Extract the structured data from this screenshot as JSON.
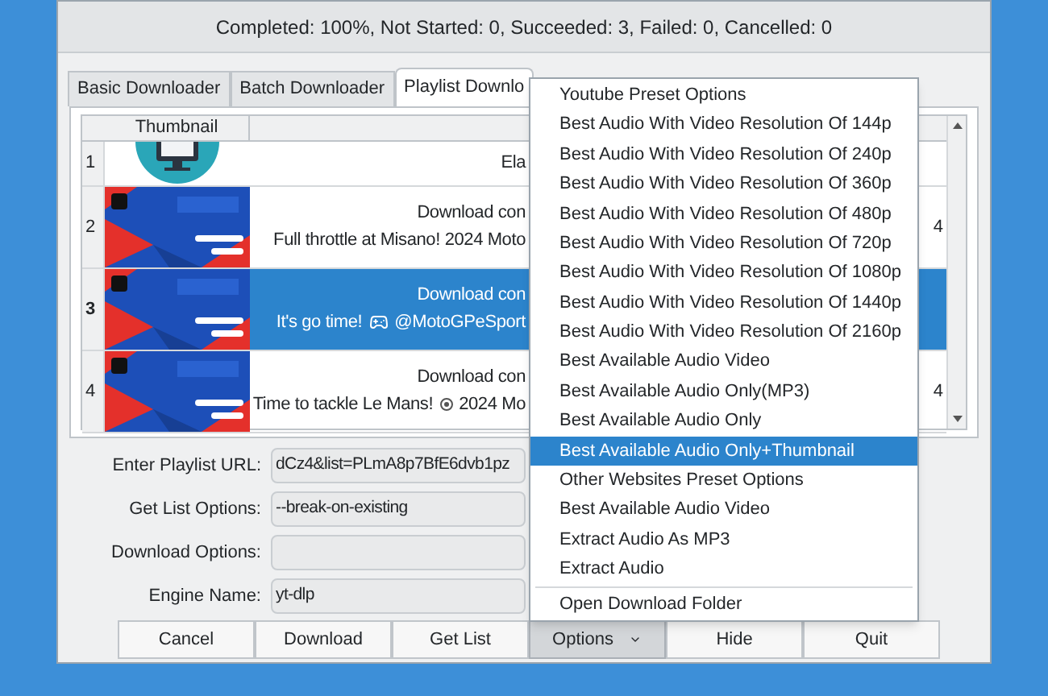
{
  "window": {
    "title": "Completed: 100%, Not Started: 0, Succeeded: 3, Failed: 0, Cancelled: 0"
  },
  "tabs": [
    {
      "label": "Basic Downloader",
      "selected": false
    },
    {
      "label": "Batch Downloader",
      "selected": false
    },
    {
      "label": "Playlist Downlo",
      "selected": true
    }
  ],
  "table": {
    "columns": [
      "Thumbnail"
    ],
    "rows": [
      {
        "number": "1",
        "thumbnail": {
          "kind": "monitor"
        },
        "lines": [
          "Ela"
        ],
        "selected": false
      },
      {
        "number": "2",
        "thumbnail": {
          "kind": "picture"
        },
        "lines": [
          "Download con",
          "Full throttle at Misano! 2024 Moto"
        ],
        "tail": "4",
        "selected": false
      },
      {
        "number": "3",
        "thumbnail": {
          "kind": "picture"
        },
        "lines": [
          "Download con",
          "It's go time!"
        ],
        "emoji": {
          "kind": "gamepad"
        },
        "after": "@MotoGPeSport",
        "selected": true
      },
      {
        "number": "4",
        "thumbnail": {
          "kind": "picture"
        },
        "lines": [
          "Download con",
          "Time to tackle Le Mans!"
        ],
        "emoji": {
          "kind": "badge"
        },
        "after": "2024 Mo",
        "tail": "4",
        "selected": false
      }
    ]
  },
  "form": [
    {
      "label": "Enter Playlist URL:",
      "value": "dCz4&list=PLmA8p7BfE6dvb1pz"
    },
    {
      "label": "Get List Options:",
      "value": "--break-on-existing"
    },
    {
      "label": "Download Options:"
    },
    {
      "label": "Engine Name:",
      "value": "yt-dlp"
    }
  ],
  "buttons": [
    {
      "label": "Cancel",
      "pressed": false
    },
    {
      "label": "Download",
      "pressed": false
    },
    {
      "label": "Get List",
      "pressed": false
    },
    {
      "label": "Options",
      "pressed": true,
      "dropdown": true
    },
    {
      "label": "Hide",
      "pressed": false
    },
    {
      "label": "Quit",
      "pressed": false
    }
  ],
  "menu": [
    {
      "kind": "header",
      "label": "Youtube Preset Options",
      "selected": false
    },
    {
      "kind": "item",
      "label": "Best Audio With Video Resolution Of 144p",
      "selected": false
    },
    {
      "kind": "item",
      "label": "Best Audio With Video Resolution Of 240p",
      "selected": false
    },
    {
      "kind": "item",
      "label": "Best Audio With Video Resolution Of 360p",
      "selected": false
    },
    {
      "kind": "item",
      "label": "Best Audio With Video Resolution Of 480p",
      "selected": false
    },
    {
      "kind": "item",
      "label": "Best Audio With Video Resolution Of 720p",
      "selected": false
    },
    {
      "kind": "item",
      "label": "Best Audio With Video Resolution Of 1080p",
      "selected": false
    },
    {
      "kind": "item",
      "label": "Best Audio With Video Resolution Of 1440p",
      "selected": false
    },
    {
      "kind": "item",
      "label": "Best Audio With Video Resolution Of 2160p",
      "selected": false
    },
    {
      "kind": "item",
      "label": "Best Available Audio Video",
      "selected": false
    },
    {
      "kind": "item",
      "label": "Best Available Audio Only(MP3)",
      "selected": false
    },
    {
      "kind": "item",
      "label": "Best Available Audio Only",
      "selected": false
    },
    {
      "kind": "item",
      "label": "Best Available Audio Only+Thumbnail",
      "selected": true
    },
    {
      "kind": "header",
      "label": "Other Websites Preset Options",
      "selected": false
    },
    {
      "kind": "item",
      "label": "Best Available Audio Video",
      "selected": false
    },
    {
      "kind": "item",
      "label": "Extract Audio As MP3",
      "selected": false
    },
    {
      "kind": "item",
      "label": "Extract Audio",
      "selected": false
    },
    {
      "kind": "separator"
    },
    {
      "kind": "item",
      "label": "Open Download Folder",
      "selected": false
    }
  ]
}
